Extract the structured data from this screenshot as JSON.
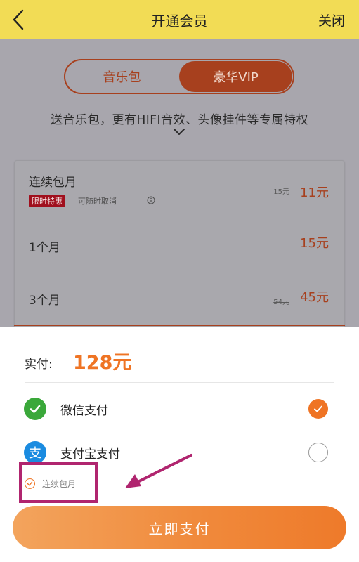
{
  "header": {
    "title": "开通会员",
    "close_label": "关闭"
  },
  "segments": [
    {
      "label": "音乐包",
      "selected": false
    },
    {
      "label": "豪华VIP",
      "selected": true
    }
  ],
  "promo_text": "送音乐包，更有HIFI音效、头像挂件等专属特权",
  "plans": [
    {
      "name": "连续包月",
      "price": "11元",
      "original_price": "15元",
      "badge": "限时特惠",
      "note": "可随时取消"
    },
    {
      "name": "1个月",
      "price": "15元"
    },
    {
      "name": "3个月",
      "price": "45元",
      "original_price": "54元"
    }
  ],
  "sheet": {
    "amount_label": "实付:",
    "amount": "128元",
    "methods": [
      {
        "label": "微信支付",
        "icon": "wechat-pay-icon",
        "selected": true
      },
      {
        "label": "支付宝支付",
        "icon": "alipay-icon",
        "icon_glyph": "支",
        "selected": false
      }
    ],
    "auto_renew_label": "连续包月",
    "pay_button_label": "立即支付"
  },
  "colors": {
    "header_bg": "#f2dc55",
    "accent_orange": "#ef7424",
    "segment_red": "#a7401e",
    "badge_red": "#a00f1d",
    "annotation_magenta": "#b0256f"
  }
}
